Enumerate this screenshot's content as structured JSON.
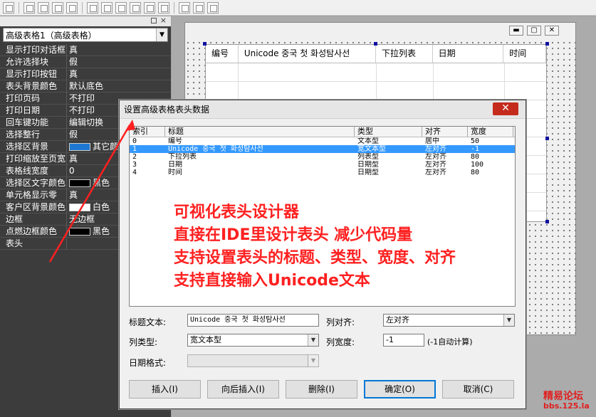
{
  "property_panel": {
    "selector": "高级表格1（高级表格）",
    "rows": [
      {
        "name": "显示打印对话框",
        "value": "真"
      },
      {
        "name": "允许选择块",
        "value": "假"
      },
      {
        "name": "显示打印按钮",
        "value": "真"
      },
      {
        "name": "表头背景颜色",
        "value": "默认底色"
      },
      {
        "name": "打印页码",
        "value": "不打印"
      },
      {
        "name": "打印日期",
        "value": "不打印"
      },
      {
        "name": "回车键功能",
        "value": "编辑切换"
      },
      {
        "name": "选择整行",
        "value": "假"
      },
      {
        "name": "选择区背景",
        "value": "其它颜色",
        "swatch": "#1e78d2"
      },
      {
        "name": "打印缩放至页宽",
        "value": "真"
      },
      {
        "name": "表格线宽度",
        "value": "0"
      },
      {
        "name": "选择区文字颜色",
        "value": "黑色",
        "swatch": "#000000"
      },
      {
        "name": "单元格显示零",
        "value": "真"
      },
      {
        "name": "客户区背景颜色",
        "value": "白色",
        "swatch": "#ffffff"
      },
      {
        "name": "边框",
        "value": "无边框"
      },
      {
        "name": "点燃边框颜色",
        "value": "黑色",
        "swatch": "#000000"
      },
      {
        "name": "表头",
        "value": ""
      }
    ]
  },
  "canvas_grid": {
    "headers": [
      "编号",
      "Unicode 중국 첫 화성탐사선",
      "下拉列表",
      "日期",
      "时间"
    ]
  },
  "dialog": {
    "title": "设置高级表格表头数据",
    "close_label": "✕",
    "list_headers": [
      "索引",
      "标题",
      "类型",
      "对齐",
      "宽度"
    ],
    "rows": [
      {
        "index": "0",
        "title": "编号",
        "type": "文本型",
        "align": "居中",
        "width": "50"
      },
      {
        "index": "1",
        "title": "Unicode 중국 첫 화성탐사선",
        "type": "宽文本型",
        "align": "左对齐",
        "width": "-1",
        "selected": true
      },
      {
        "index": "2",
        "title": "下拉列表",
        "type": "列表型",
        "align": "左对齐",
        "width": "80"
      },
      {
        "index": "3",
        "title": "日期",
        "type": "日期型",
        "align": "左对齐",
        "width": "100"
      },
      {
        "index": "4",
        "title": "时间",
        "type": "日期型",
        "align": "左对齐",
        "width": "80"
      }
    ],
    "overlay_lines": [
      "可视化表头设计器",
      "直接在IDE里设计表头 减少代码量",
      "支持设置表头的标题、类型、宽度、对齐",
      "支持直接输入Unicode文本"
    ],
    "fields": {
      "title_label": "标题文本:",
      "title_value": "Unicode 중국 첫 화성탐사선",
      "align_label": "列对齐:",
      "align_value": "左对齐",
      "type_label": "列类型:",
      "type_value": "宽文本型",
      "width_label": "列宽度:",
      "width_value": "-1",
      "width_hint": "(-1自动计算)",
      "date_label": "日期格式:",
      "date_value": ""
    },
    "buttons": {
      "insert": "插入(I)",
      "insert_after": "向后插入(I)",
      "delete": "删除(I)",
      "ok": "确定(O)",
      "cancel": "取消(C)"
    }
  },
  "watermark": {
    "line1": "精易论坛",
    "line2": "bbs.125.la"
  },
  "colors": {
    "accent": "#3399ff",
    "overlay_text": "#ff2020",
    "panel_bg": "#3c3c3c",
    "close_red": "#c42b1c"
  }
}
